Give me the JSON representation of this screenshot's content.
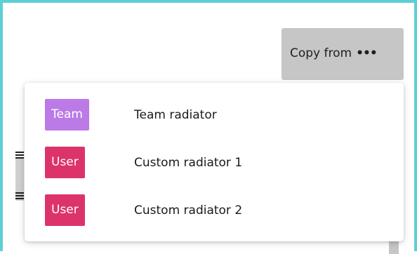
{
  "copy_button": {
    "label": "Copy from",
    "more_glyph": "•••",
    "icon": "more-horizontal-icon"
  },
  "dropdown": {
    "items": [
      {
        "badge": "Team",
        "badge_color": "#bb7ae6",
        "name": "Team radiator"
      },
      {
        "badge": "User",
        "badge_color": "#dd336b",
        "name": "Custom radiator 1"
      },
      {
        "badge": "User",
        "badge_color": "#dd336b",
        "name": "Custom radiator 2"
      }
    ]
  },
  "colors": {
    "frame_border": "#5dd0d6",
    "button_bg": "#c6c6c6"
  }
}
